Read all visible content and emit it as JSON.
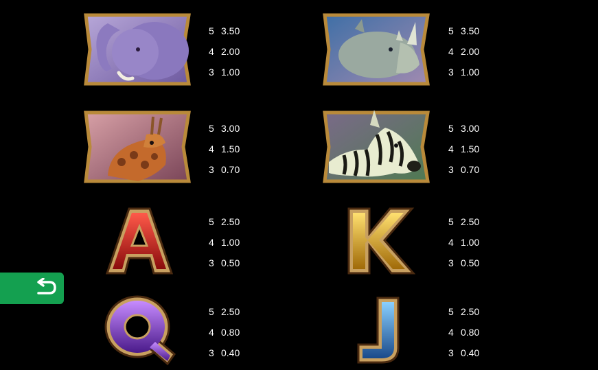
{
  "colors": {
    "background": "#000000",
    "frame_gold": "#b98a3a",
    "back_button": "#14a050"
  },
  "symbols": [
    {
      "name": "elephant",
      "icon": "elephant-icon",
      "pays": [
        {
          "count": "5",
          "value": "3.50"
        },
        {
          "count": "4",
          "value": "2.00"
        },
        {
          "count": "3",
          "value": "1.00"
        }
      ]
    },
    {
      "name": "rhino",
      "icon": "rhino-icon",
      "pays": [
        {
          "count": "5",
          "value": "3.50"
        },
        {
          "count": "4",
          "value": "2.00"
        },
        {
          "count": "3",
          "value": "1.00"
        }
      ]
    },
    {
      "name": "giraffe",
      "icon": "giraffe-icon",
      "pays": [
        {
          "count": "5",
          "value": "3.00"
        },
        {
          "count": "4",
          "value": "1.50"
        },
        {
          "count": "3",
          "value": "0.70"
        }
      ]
    },
    {
      "name": "zebra",
      "icon": "zebra-icon",
      "pays": [
        {
          "count": "5",
          "value": "3.00"
        },
        {
          "count": "4",
          "value": "1.50"
        },
        {
          "count": "3",
          "value": "0.70"
        }
      ]
    },
    {
      "name": "A",
      "icon": "letter-a-icon",
      "letter": "A",
      "pays": [
        {
          "count": "5",
          "value": "2.50"
        },
        {
          "count": "4",
          "value": "1.00"
        },
        {
          "count": "3",
          "value": "0.50"
        }
      ]
    },
    {
      "name": "K",
      "icon": "letter-k-icon",
      "letter": "K",
      "pays": [
        {
          "count": "5",
          "value": "2.50"
        },
        {
          "count": "4",
          "value": "1.00"
        },
        {
          "count": "3",
          "value": "0.50"
        }
      ]
    },
    {
      "name": "Q",
      "icon": "letter-q-icon",
      "letter": "Q",
      "pays": [
        {
          "count": "5",
          "value": "2.50"
        },
        {
          "count": "4",
          "value": "0.80"
        },
        {
          "count": "3",
          "value": "0.40"
        }
      ]
    },
    {
      "name": "J",
      "icon": "letter-j-icon",
      "letter": "J",
      "pays": [
        {
          "count": "5",
          "value": "2.50"
        },
        {
          "count": "4",
          "value": "0.80"
        },
        {
          "count": "3",
          "value": "0.40"
        }
      ]
    }
  ],
  "back_button": {
    "icon": "return-arrow-icon"
  }
}
